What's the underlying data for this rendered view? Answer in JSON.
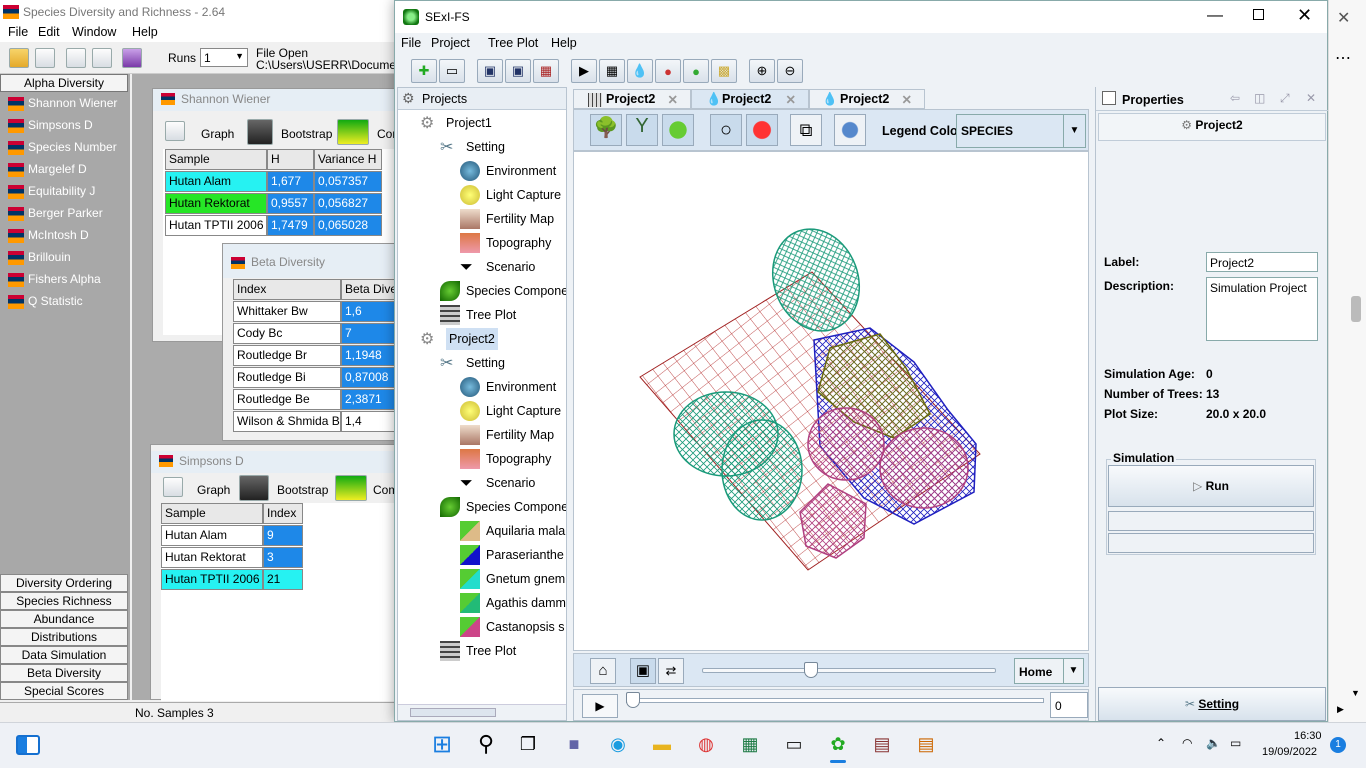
{
  "species_app": {
    "title": "Species Diversity and Richness - 2.64",
    "menu": [
      "File",
      "Edit",
      "Window",
      "Help"
    ],
    "runs_label": "Runs",
    "runs_value": "1",
    "file_open_label": "File Open",
    "file_path": "C:\\Users\\USERR\\Documen",
    "nav_header": "Alpha Diversity",
    "nav_items": [
      "Shannon Wiener",
      "Simpsons D",
      "Species Number",
      "Margelef D",
      "Equitability J",
      "Berger Parker",
      "McIntosh D",
      "Brillouin",
      "Fishers Alpha",
      "Q Statistic"
    ],
    "bottom_buttons": [
      "Diversity Ordering",
      "Species Richness",
      "Abundance",
      "Distributions",
      "Data Simulation",
      "Beta Diversity",
      "Special Scores"
    ],
    "status": "No. Samples 3",
    "shannon": {
      "title": "Shannon Wiener",
      "toolbar": [
        "Graph",
        "Bootstrap",
        "Con"
      ],
      "headers": [
        "Sample",
        "H",
        "Variance H"
      ],
      "rows": [
        [
          "Hutan Alam",
          "1,677",
          "0,057357"
        ],
        [
          "Hutan Rektorat",
          "0,9557",
          "0,056827"
        ],
        [
          "Hutan TPTII 2006",
          "1,7479",
          "0,065028"
        ]
      ]
    },
    "beta": {
      "title": "Beta Diversity",
      "headers": [
        "Index",
        "Beta Diver"
      ],
      "rows": [
        [
          "Whittaker Bw",
          "1,6"
        ],
        [
          "Cody Bc",
          "7"
        ],
        [
          "Routledge Br",
          "1,1948"
        ],
        [
          "Routledge Bi",
          "0,87008"
        ],
        [
          "Routledge Be",
          "2,3871"
        ],
        [
          "Wilson & Shmida Bt",
          "1,4"
        ]
      ]
    },
    "simpsons": {
      "title": "Simpsons D",
      "toolbar": [
        "Graph",
        "Bootstrap",
        "Com"
      ],
      "headers": [
        "Sample",
        "Index"
      ],
      "rows": [
        [
          "Hutan Alam",
          "9"
        ],
        [
          "Hutan Rektorat",
          "3"
        ],
        [
          "Hutan TPTII 2006",
          "21"
        ]
      ]
    }
  },
  "sexi": {
    "title": "SExI-FS",
    "menu": [
      "File",
      "Project",
      "Tree Plot",
      "Help"
    ],
    "projects_label": "Projects",
    "tree": {
      "project1": "Project1",
      "setting": "Setting",
      "environment": "Environment",
      "light": "Light Capture",
      "fertility": "Fertility Map",
      "topography": "Topography",
      "scenario": "Scenario",
      "species_comp_1": "Species Compone",
      "treeplot_1": "Tree Plot",
      "project2": "Project2",
      "species_comp_2": "Species Compone",
      "species": [
        "Aquilaria mala",
        "Paraserianthe",
        "Gnetum gnem",
        "Agathis damm",
        "Castanopsis s"
      ],
      "treeplot_2": "Tree Plot"
    },
    "tabs": [
      "Project2",
      "Project2",
      "Project2"
    ],
    "legend_label": "Legend Color",
    "legend_value": "SPECIES",
    "view_select": "Home",
    "time_value": "0",
    "properties": {
      "header": "Properties",
      "project": "Project2",
      "label_label": "Label:",
      "label_value": "Project2",
      "desc_label": "Description:",
      "desc_value": "Simulation Project",
      "age_label": "Simulation Age:",
      "age_value": "0",
      "trees_label": "Number of Trees:",
      "trees_value": "13",
      "size_label": "Plot Size:",
      "size_value": "20.0 x 20.0",
      "sim_group": "Simulation",
      "run_label": "Run",
      "setting_label": "Setting"
    }
  },
  "taskbar": {
    "time": "16:30",
    "date": "19/09/2022",
    "notification_count": "1"
  },
  "colors": {
    "selected_tab": "#dbe7f3",
    "cyan_cell": "#26f2f2",
    "blue_cell": "#1e88e8",
    "green_cell": "#26e626"
  }
}
